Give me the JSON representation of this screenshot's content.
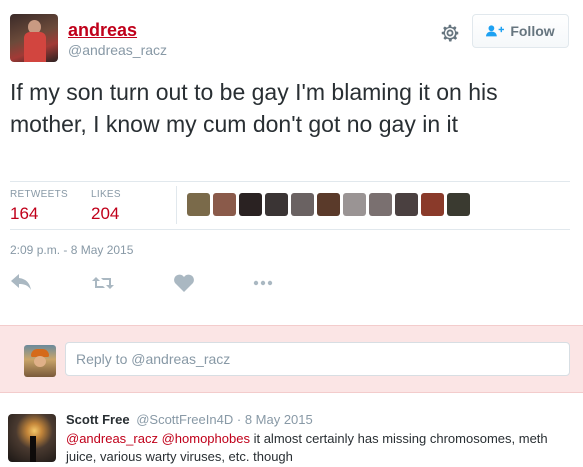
{
  "tweet": {
    "display_name": "andreas",
    "screen_name": "@andreas_racz",
    "follow_label": "Follow",
    "text": "If my son turn out to be gay I'm blaming it on his mother, I know my cum don't got no gay in it",
    "stats": {
      "retweets_label": "RETWEETS",
      "retweets_count": "164",
      "likes_label": "LIKES",
      "likes_count": "204"
    },
    "likers": [
      {
        "name": "liker-1",
        "color": "#7a6a4a"
      },
      {
        "name": "liker-2",
        "color": "#8a5a4a"
      },
      {
        "name": "liker-3",
        "color": "#2a2222"
      },
      {
        "name": "liker-4",
        "color": "#3a3434"
      },
      {
        "name": "liker-5",
        "color": "#6a6262"
      },
      {
        "name": "liker-6",
        "color": "#5a3a2a"
      },
      {
        "name": "liker-7",
        "color": "#9a9494"
      },
      {
        "name": "liker-8",
        "color": "#7a7070"
      },
      {
        "name": "liker-9",
        "color": "#4a4040"
      },
      {
        "name": "liker-10",
        "color": "#8a3a2a"
      },
      {
        "name": "liker-11",
        "color": "#3a3a30"
      }
    ],
    "timestamp": "2:09 p.m. - 8 May 2015",
    "actions": [
      "reply-icon",
      "retweet-icon",
      "like-icon",
      "more-icon"
    ]
  },
  "reply_box": {
    "placeholder": "Reply to @andreas_racz"
  },
  "reply_tweet": {
    "name": "Scott Free",
    "handle": "@ScottFreeIn4D",
    "separator": "·",
    "date": "8 May 2015",
    "mention_1": "@andreas_racz",
    "mention_2": "@homophobes",
    "text": "it almost certainly has missing chromosomes, meth juice, various warty viruses, etc. though"
  },
  "colors": {
    "accent": "#c0001a",
    "muted": "#8899a6",
    "reply_bg": "#fbe5e5"
  }
}
